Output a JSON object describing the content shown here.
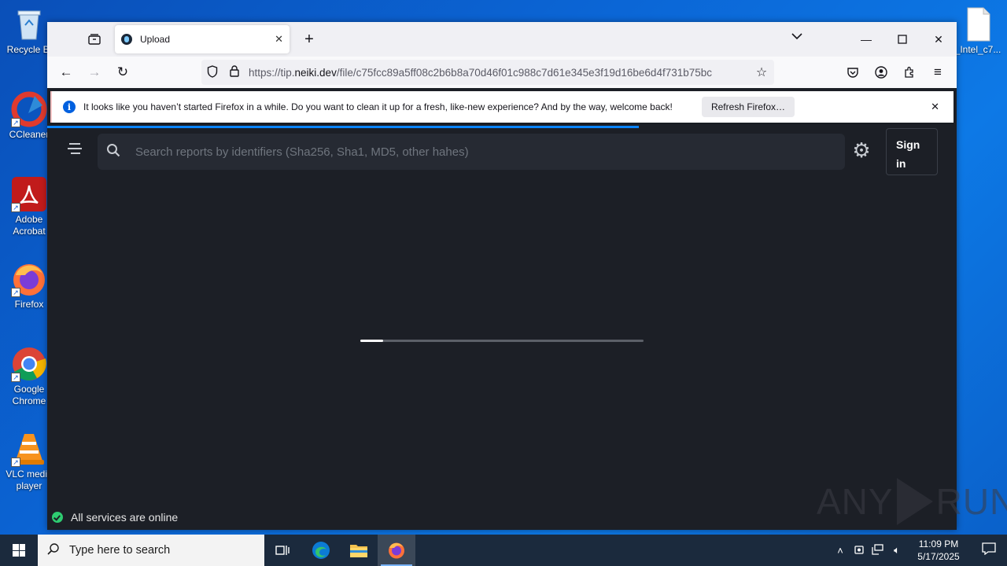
{
  "desktop": {
    "icons": [
      {
        "label": "Recycle Bi",
        "icon": "recycle-bin-icon"
      },
      {
        "label": "CCleaner",
        "icon": "ccleaner-icon"
      },
      {
        "label": "Adobe Acrobat",
        "icon": "adobe-acrobat-icon"
      },
      {
        "label": "Firefox",
        "icon": "firefox-icon"
      },
      {
        "label": "Google Chrome",
        "icon": "google-chrome-icon"
      },
      {
        "label": "VLC media player",
        "icon": "vlc-icon"
      },
      {
        "label": "_Intel_c7...",
        "icon": "file-icon"
      }
    ]
  },
  "browser": {
    "tab": {
      "title": "Upload"
    },
    "url": {
      "scheme_host_prefix": "https://tip.",
      "domain": "neiki.dev",
      "path": "/file/c75fcc89a5ff08c2b6b8a70d46f01c988c7d61e345e3f19d16be6d4f731b75bc"
    },
    "notification": {
      "message": "It looks like you haven’t started Firefox in a while. Do you want to clean it up for a fresh, like-new experience? And by the way, welcome back!",
      "button": "Refresh Firefox…"
    }
  },
  "page": {
    "search_placeholder": "Search reports by identifiers (Sha256, Sha1, MD5, other hahes)",
    "signin_line1": "Sign",
    "signin_line2": "in",
    "loading_progress": 0.08,
    "status_text": "All services are online"
  },
  "watermark": {
    "left": "ANY",
    "right": "RUN"
  },
  "taskbar": {
    "search_placeholder": "Type here to search",
    "time": "11:09 PM",
    "date": "5/17/2025"
  },
  "colors": {
    "accent": "#0a84ff",
    "page_bg": "#1c1f26",
    "status_ok": "#2ecc71"
  }
}
